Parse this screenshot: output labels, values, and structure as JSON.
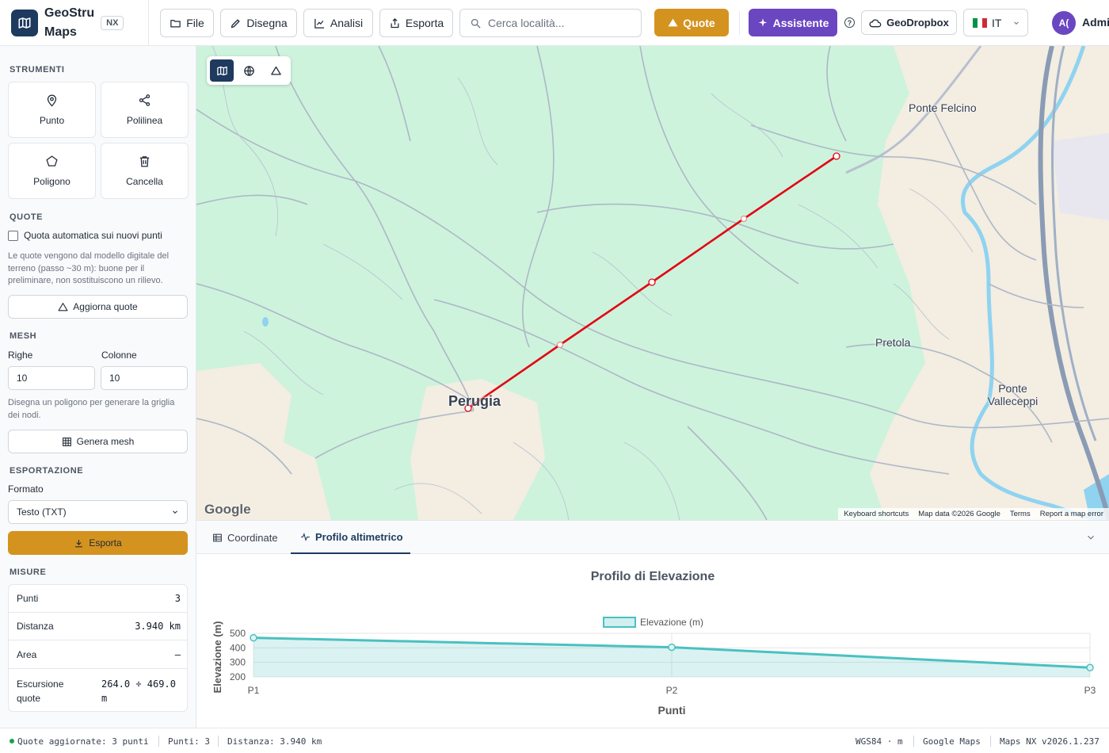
{
  "app": {
    "brand_line1": "GeoStru",
    "brand_line2": "Maps",
    "badge": "NX"
  },
  "toolbar": {
    "file": "File",
    "draw": "Disegna",
    "analysis": "Analisi",
    "export": "Esporta",
    "search_placeholder": "Cerca località...",
    "quote": "Quote",
    "assistant": "Assistente",
    "help": "?",
    "geodropbox": "GeoDropbox",
    "language": "IT",
    "avatar": "A(",
    "user": "Admin"
  },
  "sidebar": {
    "tools_title": "STRUMENTI",
    "tools": {
      "point": "Punto",
      "polyline": "Polilinea",
      "polygon": "Poligono",
      "delete": "Cancella"
    },
    "quote_title": "QUOTE",
    "auto_quote_label": "Quota automatica sui nuovi punti",
    "auto_quote_checked": false,
    "quote_note": "Le quote vengono dal modello digitale del terreno (passo ~30 m): buone per il preliminare, non sostituiscono un rilievo.",
    "update_quotes": "Aggiorna quote",
    "mesh_title": "MESH",
    "rows_label": "Righe",
    "cols_label": "Colonne",
    "rows_value": "10",
    "cols_value": "10",
    "mesh_note": "Disegna un poligono per generare la griglia dei nodi.",
    "generate_mesh": "Genera mesh",
    "export_title": "ESPORTAZIONE",
    "format_label": "Formato",
    "format_value": "Testo (TXT)",
    "export_button": "Esporta",
    "measures_title": "MISURE",
    "measures": {
      "points_label": "Punti",
      "points_value": "3",
      "distance_label": "Distanza",
      "distance_value": "3.940 km",
      "area_label": "Area",
      "area_value": "—",
      "range_label_1": "Escursione",
      "range_label_2": "quote",
      "range_value_1": "264.0 ÷ 469.0",
      "range_value_2": "m"
    }
  },
  "map": {
    "places": {
      "ponte_felcino": "Ponte Felcino",
      "perugia": "Perugia",
      "pretola": "Pretola",
      "ponte_valleceppi_1": "Ponte",
      "ponte_valleceppi_2": "Valleceppi"
    },
    "google": "Google",
    "attribution": {
      "shortcuts": "Keyboard shortcuts",
      "data": "Map data ©2026 Google",
      "terms": "Terms",
      "report": "Report a map error"
    },
    "route_color": "#e30613"
  },
  "panel": {
    "tab_coordinates": "Coordinate",
    "tab_profile": "Profilo altimetrico",
    "active_tab": "Profilo altimetrico"
  },
  "chart_data": {
    "type": "line",
    "title": "Profilo di Elevazione",
    "xlabel": "Punti",
    "ylabel": "Elevazione (m)",
    "categories": [
      "P1",
      "P2",
      "P3"
    ],
    "series": [
      {
        "name": "Elevazione (m)",
        "values": [
          469,
          404,
          264
        ]
      }
    ],
    "ylim": [
      200,
      500
    ],
    "yticks": [
      200,
      300,
      400,
      500
    ],
    "legend": "top",
    "grid": true,
    "fill": true,
    "color": "#4bc0c0"
  },
  "status": {
    "message": "Quote aggiornate: 3 punti",
    "points": "Punti: 3",
    "distance": "Distanza: 3.940 km",
    "crs": "WGS84 · m",
    "provider": "Google Maps",
    "version": "Maps NX v2026.1.237"
  }
}
